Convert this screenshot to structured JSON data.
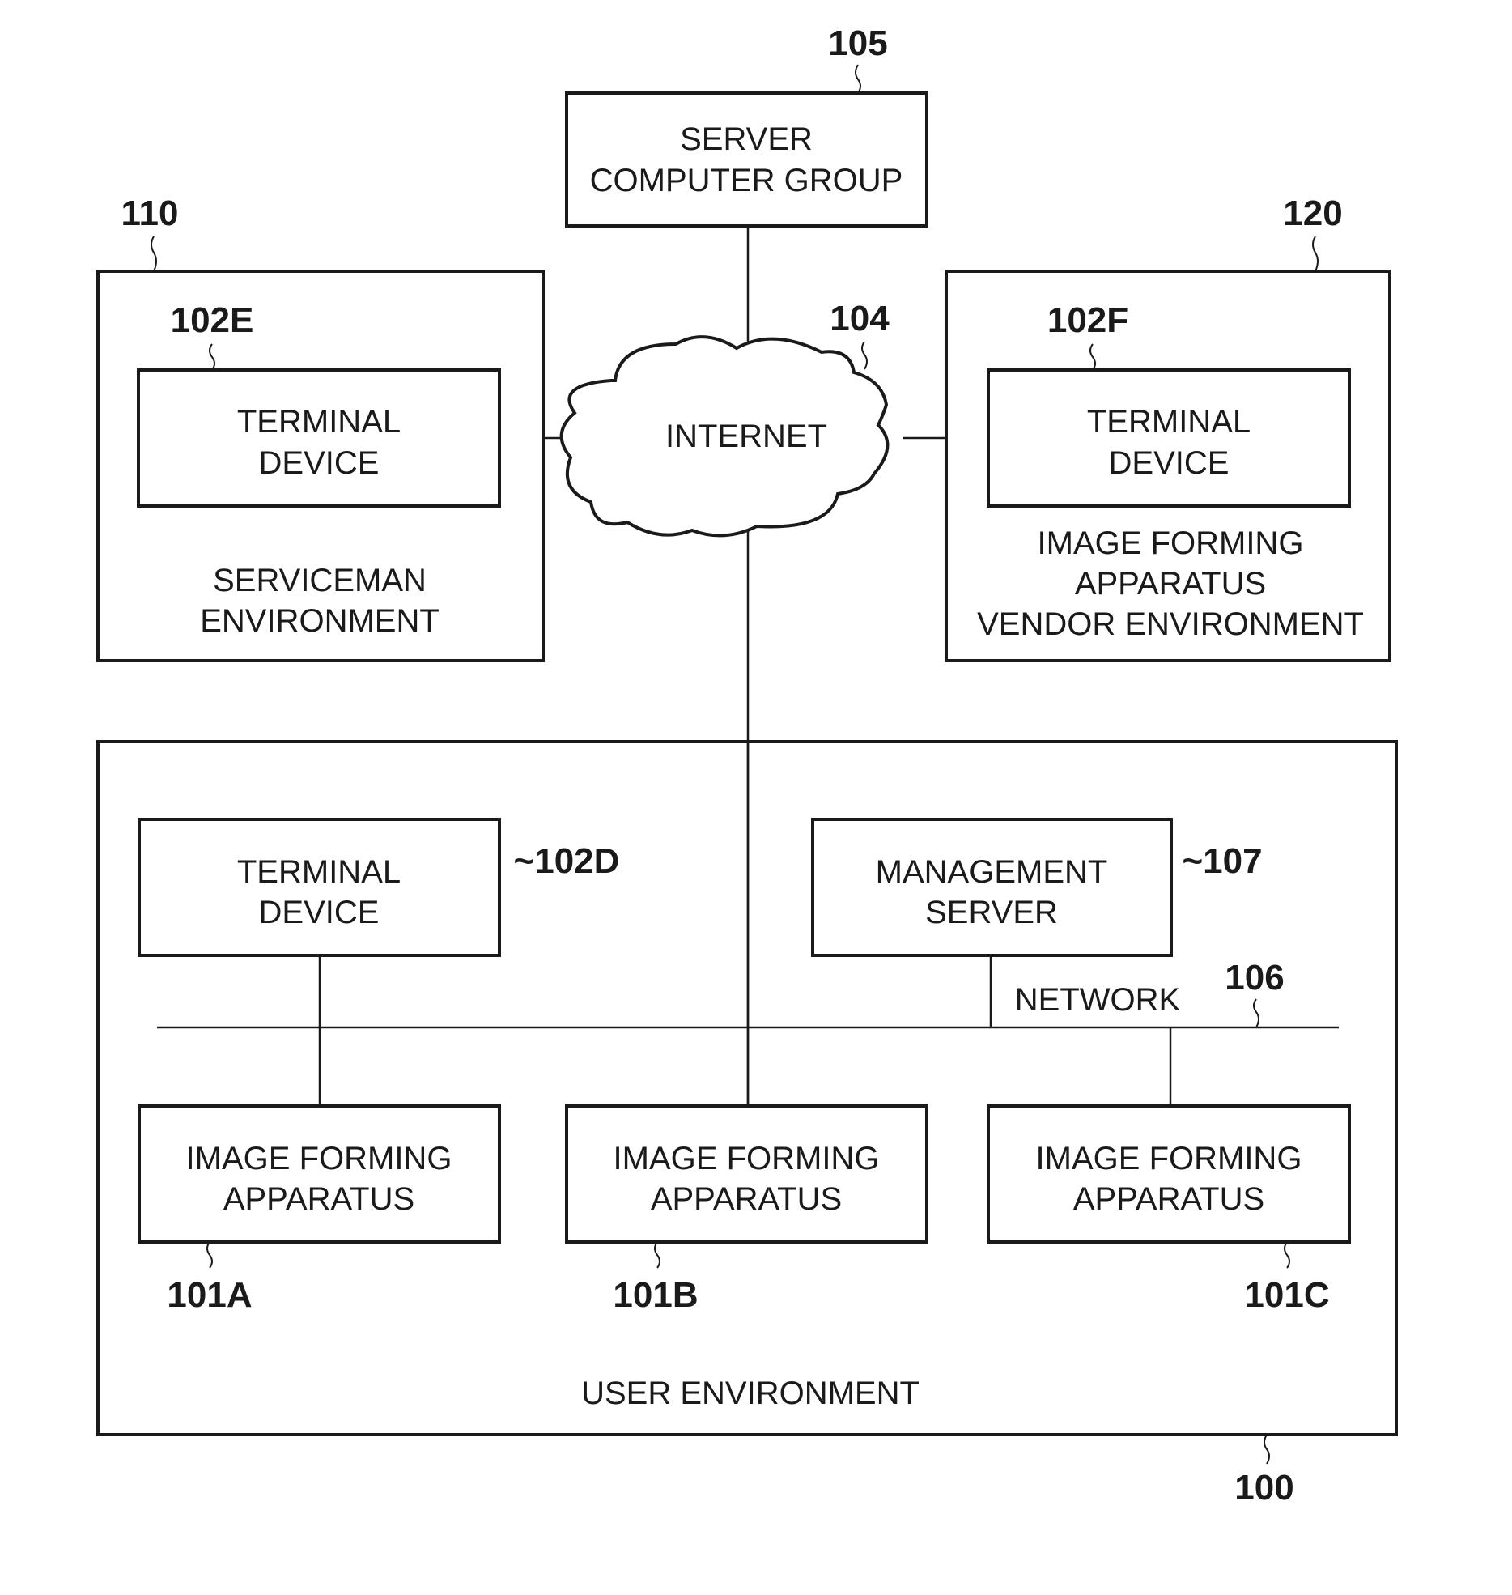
{
  "diagram": {
    "server_group": {
      "ref": "105",
      "line1": "SERVER",
      "line2": "COMPUTER GROUP"
    },
    "internet": {
      "ref": "104",
      "label": "INTERNET"
    },
    "serviceman_env": {
      "ref": "110",
      "line1": "SERVICEMAN",
      "line2": "ENVIRONMENT",
      "terminal": {
        "ref": "102E",
        "line1": "TERMINAL",
        "line2": "DEVICE"
      }
    },
    "vendor_env": {
      "ref": "120",
      "line1": "IMAGE FORMING",
      "line2": "APPARATUS",
      "line3": "VENDOR ENVIRONMENT",
      "terminal": {
        "ref": "102F",
        "line1": "TERMINAL",
        "line2": "DEVICE"
      }
    },
    "user_env": {
      "ref": "100",
      "label": "USER ENVIRONMENT",
      "terminal": {
        "ref": "102D",
        "ref_display": "~102D",
        "line1": "TERMINAL",
        "line2": "DEVICE"
      },
      "management_server": {
        "ref": "107",
        "ref_display": "~107",
        "line1": "MANAGEMENT",
        "line2": "SERVER"
      },
      "network": {
        "ref": "106",
        "label": "NETWORK"
      },
      "apparatuses": [
        {
          "ref": "101A",
          "line1": "IMAGE FORMING",
          "line2": "APPARATUS"
        },
        {
          "ref": "101B",
          "line1": "IMAGE FORMING",
          "line2": "APPARATUS"
        },
        {
          "ref": "101C",
          "line1": "IMAGE FORMING",
          "line2": "APPARATUS"
        }
      ]
    }
  }
}
